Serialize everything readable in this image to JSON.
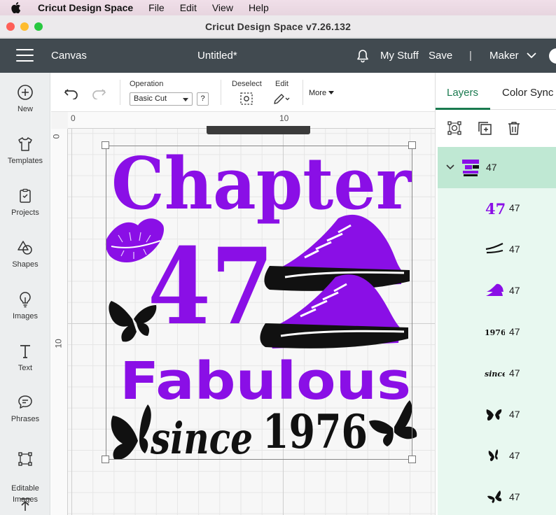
{
  "menubar": {
    "app_name": "Cricut Design Space",
    "items": [
      "File",
      "Edit",
      "View",
      "Help"
    ]
  },
  "window": {
    "title": "Cricut Design Space  v7.26.132"
  },
  "header": {
    "canvas_label": "Canvas",
    "project_title": "Untitled*",
    "my_stuff": "My Stuff",
    "save": "Save",
    "separator": "|",
    "machine": "Maker"
  },
  "sidebar": {
    "items": [
      {
        "label": "New",
        "icon": "plus-circle-icon"
      },
      {
        "label": "Templates",
        "icon": "tshirt-icon"
      },
      {
        "label": "Projects",
        "icon": "clipboard-icon"
      },
      {
        "label": "Shapes",
        "icon": "shapes-icon"
      },
      {
        "label": "Images",
        "icon": "lightbulb-icon"
      },
      {
        "label": "Text",
        "icon": "text-t-icon"
      },
      {
        "label": "Phrases",
        "icon": "speech-bubble-icon"
      },
      {
        "label": "Editable\nImages",
        "icon": "editable-image-icon"
      }
    ]
  },
  "toolbar": {
    "operation_label": "Operation",
    "operation_value": "Basic Cut",
    "help": "?",
    "deselect_label": "Deselect",
    "edit_label": "Edit",
    "more_label": "More"
  },
  "canvas": {
    "ruler_top": [
      "0",
      "10"
    ],
    "ruler_left": [
      "0",
      "10"
    ],
    "design": {
      "line1": "Chapter",
      "line2": "47",
      "line3": "Fabulous",
      "line4a": "since",
      "line4b": "1976"
    }
  },
  "right_panel": {
    "tabs": [
      "Layers",
      "Color Sync"
    ],
    "active_tab": "Layers",
    "group": {
      "name": "47",
      "expanded": true
    },
    "layers": [
      {
        "name": "47",
        "thumb": "47-text"
      },
      {
        "name": "47",
        "thumb": "swoosh"
      },
      {
        "name": "47",
        "thumb": "sneakers"
      },
      {
        "name": "47",
        "thumb": "1976-text"
      },
      {
        "name": "47",
        "thumb": "since-script"
      },
      {
        "name": "47",
        "thumb": "butterfly"
      },
      {
        "name": "47",
        "thumb": "butterfly-small"
      },
      {
        "name": "47",
        "thumb": "butterfly-right"
      }
    ]
  },
  "colors": {
    "purple": "#8a0fe6",
    "black": "#111111",
    "accent_green": "#1a7a4f",
    "header_bg": "#414a50"
  }
}
